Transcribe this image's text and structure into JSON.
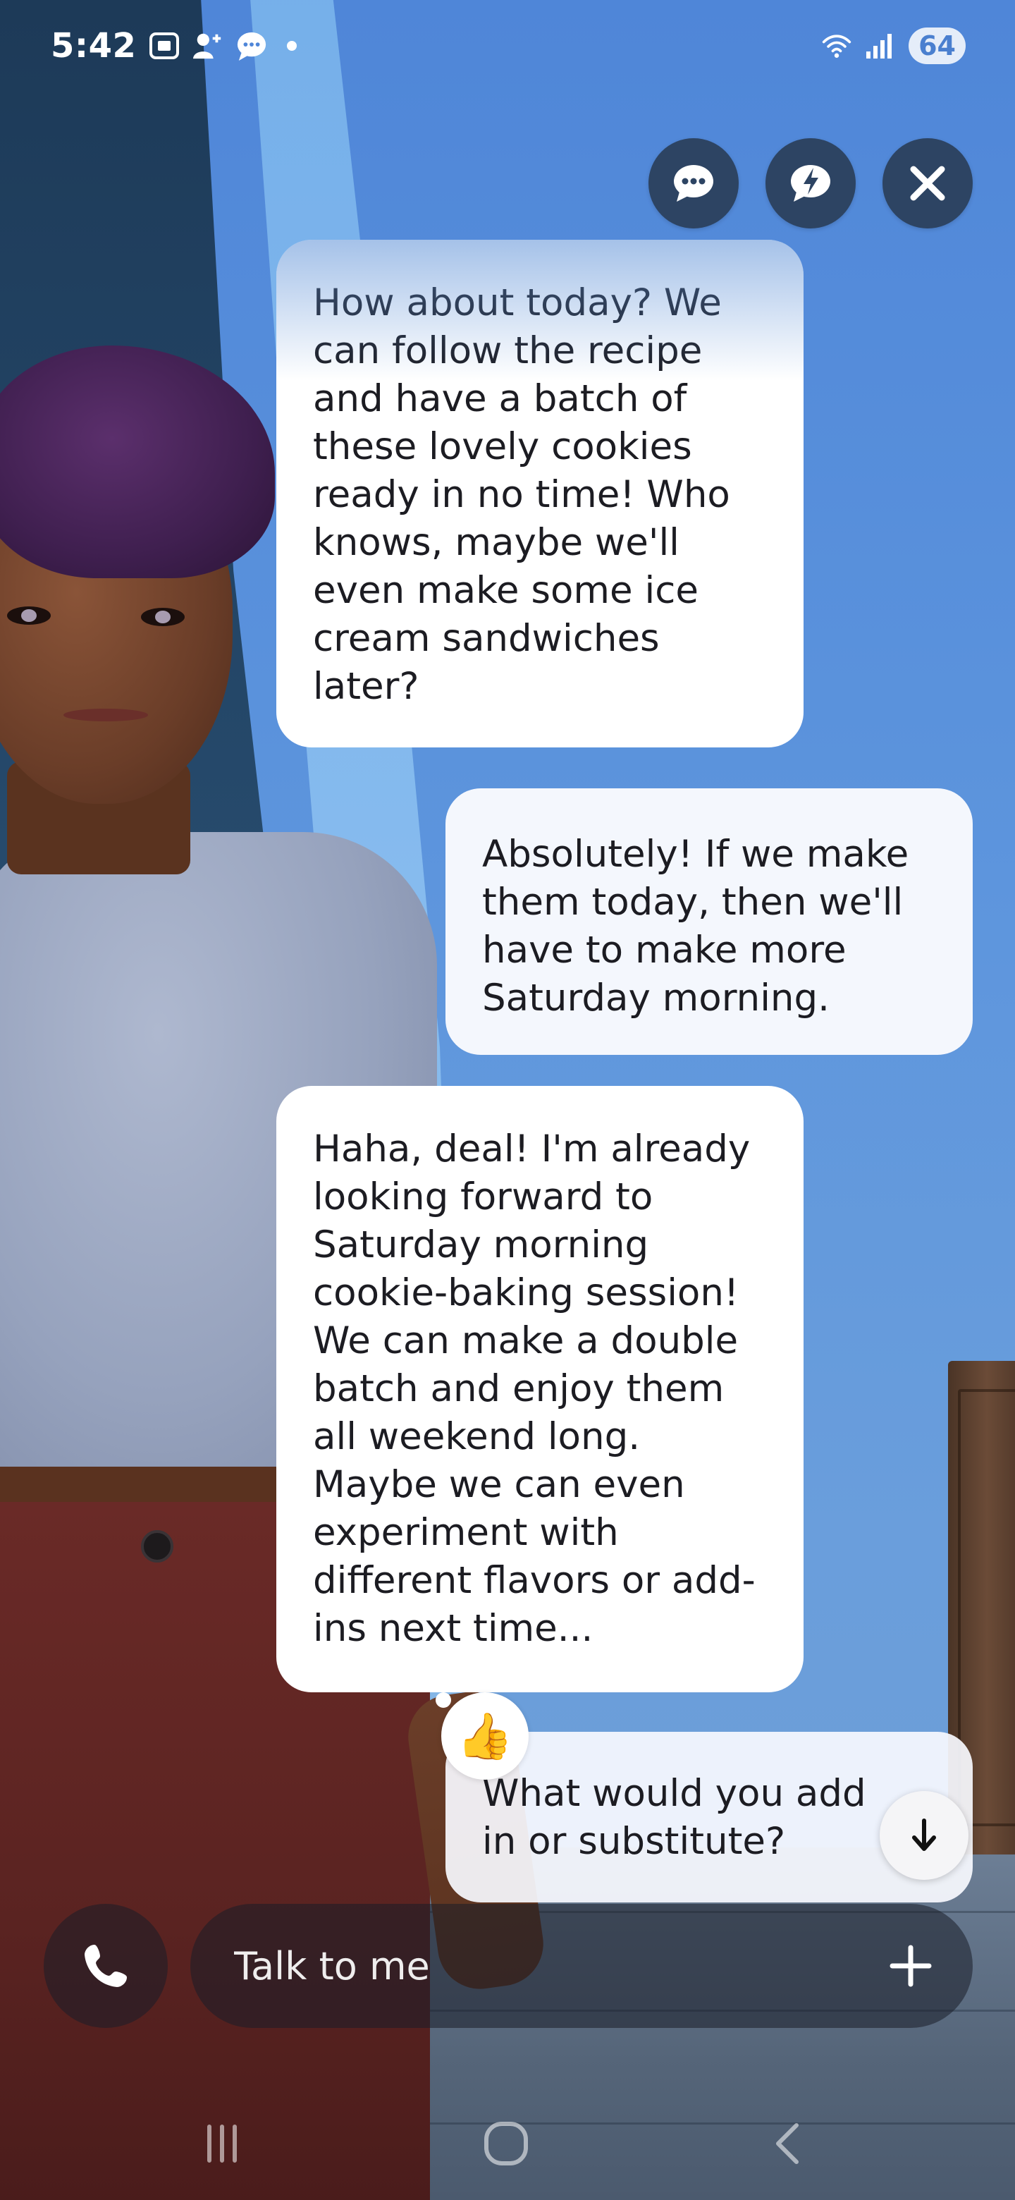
{
  "status_bar": {
    "time": "5:42",
    "battery": "64",
    "icons": [
      "screenshot-icon",
      "person-add-icon",
      "chat-bubble-icon",
      "wifi-icon",
      "signal-icon"
    ]
  },
  "top_actions": {
    "icons": [
      "chat-icon",
      "quick-reply-icon",
      "close-icon"
    ]
  },
  "messages": [
    {
      "sender": "ai",
      "text": "How about today? We can follow the recipe and have a batch of these lovely cookies ready in no time! Who knows, maybe we'll even make some ice cream sandwiches later?"
    },
    {
      "sender": "user",
      "text": "Absolutely! If we make them today, then we'll have to make more Saturday morning."
    },
    {
      "sender": "ai",
      "text": "Haha, deal! I'm already looking forward to Saturday morning cookie-baking session! We can make a double batch and enjoy them all weekend long. Maybe we can even experiment with different flavors or add-ins next time..."
    },
    {
      "sender": "user",
      "text": "What would you add in or substitute?"
    }
  ],
  "reaction": {
    "emoji": "👍"
  },
  "input": {
    "placeholder": "Talk to me"
  },
  "colors": {
    "button_bg": "#2d4463",
    "bubble_bg": "#ffffff",
    "wall": "#5b8fd6"
  }
}
